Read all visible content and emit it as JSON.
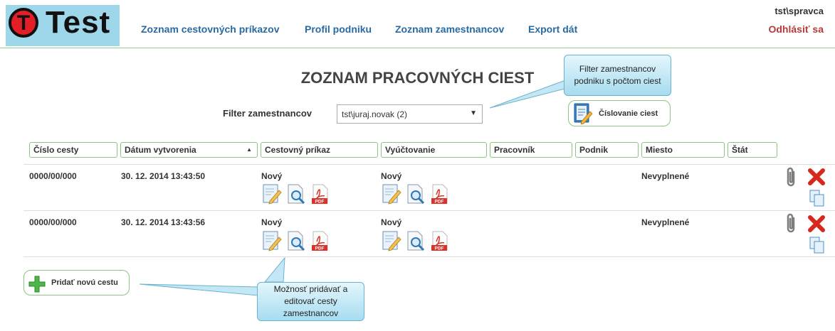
{
  "header": {
    "logo_letter": "T",
    "logo_text": "Test",
    "nav": [
      {
        "label": "Zoznam cestovných príkazov"
      },
      {
        "label": "Profil podniku"
      },
      {
        "label": "Zoznam zamestnancov"
      },
      {
        "label": "Export dát"
      }
    ],
    "user": "tst\\spravca",
    "logout": "Odhlásiť sa"
  },
  "page": {
    "title": "ZOZNAM PRACOVNÝCH CIEST",
    "filter_label": "Filter zamestnancov",
    "filter_value": "tst\\juraj.novak (2)",
    "numbering_button": "Číslovanie ciest",
    "add_button": "Pridať novú cestu"
  },
  "table": {
    "columns": [
      "Číslo cesty",
      "Dátum vytvorenia",
      "Cestovný príkaz",
      "Vyúčtovanie",
      "Pracovník",
      "Podnik",
      "Miesto",
      "Štát"
    ],
    "rows": [
      {
        "number": "0000/00/000",
        "created": "30. 12. 2014 13:43:50",
        "order_status": "Nový",
        "billing_status": "Nový",
        "worker": "",
        "company": "",
        "place": "Nevyplnené",
        "state": ""
      },
      {
        "number": "0000/00/000",
        "created": "30. 12. 2014 13:43:56",
        "order_status": "Nový",
        "billing_status": "Nový",
        "worker": "",
        "company": "",
        "place": "Nevyplnené",
        "state": ""
      }
    ]
  },
  "callouts": {
    "filter_note": "Filter zamestnancov podniku s počtom ciest",
    "edit_note": "Možnosť pridávať a editovať cesty zamestnancov"
  },
  "icons": {
    "edit": "edit-document-icon",
    "preview": "magnifier-document-icon",
    "pdf": "pdf-icon",
    "attach": "paperclip-icon",
    "delete": "delete-x-icon",
    "copy": "copy-icon",
    "add": "plus-icon"
  },
  "colors": {
    "accent_green": "#8cc582",
    "nav_blue": "#2a6aa2",
    "logout_red": "#b33a3a",
    "logo_bg": "#9fd7ea",
    "callout_bg": "#a6dcef"
  }
}
